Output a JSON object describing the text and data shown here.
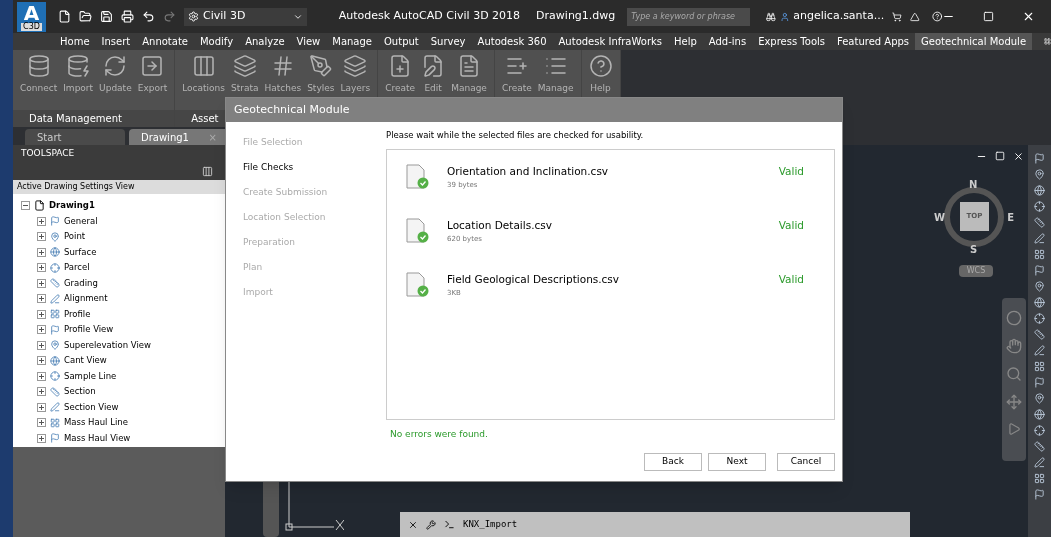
{
  "app": {
    "logo": {
      "letter": "A",
      "badge": "C3D"
    },
    "workspace": "Civil 3D",
    "title": "Autodesk AutoCAD Civil 3D 2018",
    "document": "Drawing1.dwg",
    "search": {
      "placeholder": "Type a keyword or phrase"
    },
    "user": "angelica.santa..."
  },
  "menu": [
    {
      "label": "Home",
      "selected": false
    },
    {
      "label": "Insert",
      "selected": false
    },
    {
      "label": "Annotate",
      "selected": false
    },
    {
      "label": "Modify",
      "selected": false
    },
    {
      "label": "Analyze",
      "selected": false
    },
    {
      "label": "View",
      "selected": false
    },
    {
      "label": "Manage",
      "selected": false
    },
    {
      "label": "Output",
      "selected": false
    },
    {
      "label": "Survey",
      "selected": false
    },
    {
      "label": "Autodesk 360",
      "selected": false
    },
    {
      "label": "Autodesk InfraWorks",
      "selected": false
    },
    {
      "label": "Help",
      "selected": false
    },
    {
      "label": "Add-ins",
      "selected": false
    },
    {
      "label": "Express Tools",
      "selected": false
    },
    {
      "label": "Featured Apps",
      "selected": false
    },
    {
      "label": "Geotechnical Module",
      "selected": true
    }
  ],
  "ribbon": {
    "panels": [
      {
        "title": "Data Management",
        "buttons": [
          {
            "label": "Connect",
            "disabled": true
          },
          {
            "label": "Import",
            "disabled": true
          },
          {
            "label": "Update",
            "disabled": true
          },
          {
            "label": "Export",
            "disabled": true
          }
        ]
      },
      {
        "title": "Asset",
        "buttons": [
          {
            "label": "Locations",
            "disabled": true
          },
          {
            "label": "Strata",
            "disabled": true
          },
          {
            "label": "Hatches",
            "disabled": true
          },
          {
            "label": "Styles",
            "disabled": true
          },
          {
            "label": "Layers",
            "disabled": true
          }
        ]
      },
      {
        "buttons": [
          {
            "label": "Create",
            "disabled": true
          },
          {
            "label": "Edit",
            "disabled": true
          },
          {
            "label": "Manage",
            "disabled": true
          }
        ]
      },
      {
        "buttons": [
          {
            "label": "Create",
            "disabled": true
          },
          {
            "label": "Manage",
            "disabled": true
          }
        ]
      },
      {
        "buttons": [
          {
            "label": "Help",
            "disabled": true
          }
        ]
      }
    ]
  },
  "doc_tabs": [
    {
      "label": "Start",
      "selected": false
    },
    {
      "label": "Drawing1",
      "selected": true,
      "close": "×"
    }
  ],
  "toolspace": {
    "title": "TOOLSPACE",
    "view": "Active Drawing Settings View",
    "tree": {
      "label": "Drawing1",
      "expanded": true,
      "children": [
        {
          "label": "General",
          "expanded": false
        },
        {
          "label": "Point",
          "expanded": false
        },
        {
          "label": "Surface",
          "expanded": false
        },
        {
          "label": "Parcel",
          "expanded": false
        },
        {
          "label": "Grading",
          "expanded": false
        },
        {
          "label": "Alignment",
          "expanded": false
        },
        {
          "label": "Profile",
          "expanded": false
        },
        {
          "label": "Profile View",
          "expanded": false
        },
        {
          "label": "Superelevation View",
          "expanded": false
        },
        {
          "label": "Cant View",
          "expanded": false
        },
        {
          "label": "Sample Line",
          "expanded": false
        },
        {
          "label": "Section",
          "expanded": false
        },
        {
          "label": "Section View",
          "expanded": false
        },
        {
          "label": "Mass Haul Line",
          "expanded": false
        },
        {
          "label": "Mass Haul View",
          "expanded": false
        }
      ]
    }
  },
  "viewcube": {
    "north": "N",
    "west": "W",
    "east": "E",
    "south": "S",
    "face": "TOP",
    "ucs": "WCS"
  },
  "command_line": {
    "value": "KNX_Import"
  },
  "dialog": {
    "title": "Geotechnical Module",
    "steps": [
      {
        "label": "File Selection",
        "selected": false
      },
      {
        "label": "File Checks",
        "selected": true
      },
      {
        "label": "Create Submission",
        "selected": false
      },
      {
        "label": "Location Selection",
        "selected": false
      },
      {
        "label": "Preparation",
        "selected": false
      },
      {
        "label": "Plan",
        "selected": false
      },
      {
        "label": "Import",
        "selected": false
      }
    ],
    "instruction": "Please wait while the selected files are checked for usability.",
    "files": [
      {
        "name": "Orientation and Inclination.csv",
        "size": "39 bytes",
        "status": "Valid"
      },
      {
        "name": "Location Details.csv",
        "size": "620 bytes",
        "status": "Valid"
      },
      {
        "name": "Field Geological Descriptions.csv",
        "size": "3KB",
        "status": "Valid"
      }
    ],
    "message": "No errors were found.",
    "buttons": [
      "Back",
      "Next",
      "Cancel"
    ]
  }
}
